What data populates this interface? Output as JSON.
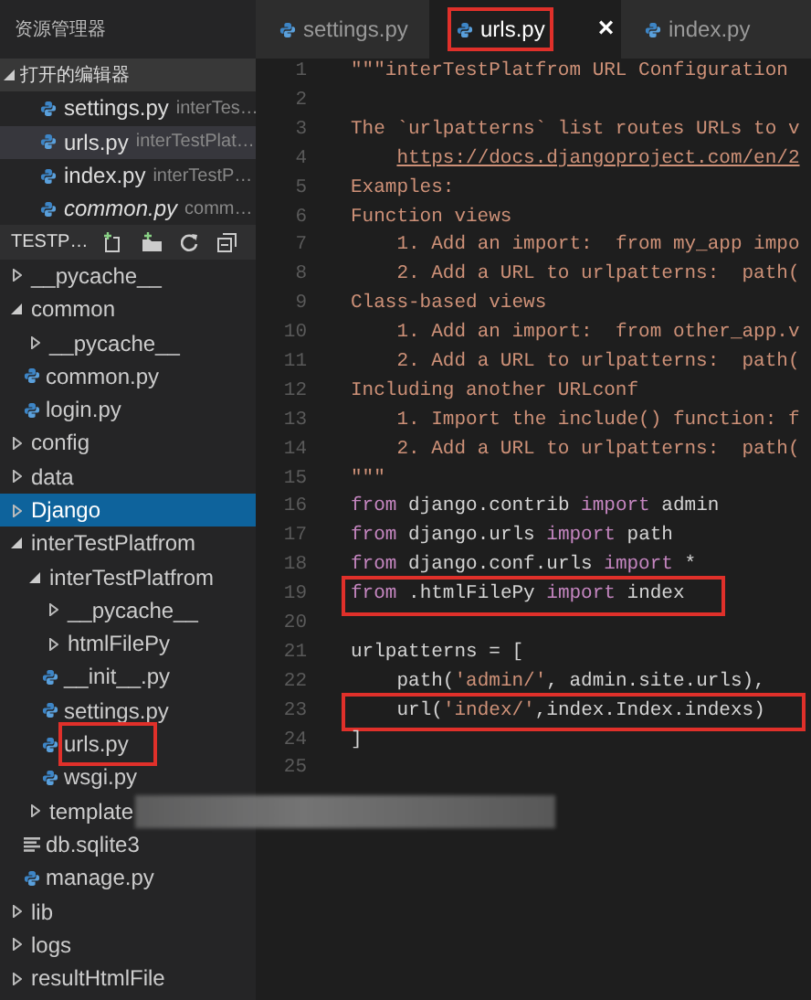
{
  "explorer": {
    "title": "资源管理器",
    "open_editors": {
      "title": "打开的编辑器",
      "expanded": true,
      "items": [
        {
          "name": "settings.py",
          "description": "interTes…",
          "selected": false,
          "preview": false
        },
        {
          "name": "urls.py",
          "description": "interTestPlat…",
          "selected": true,
          "preview": false
        },
        {
          "name": "index.py",
          "description": "interTestP…",
          "selected": false,
          "preview": false
        },
        {
          "name": "common.py",
          "description": "comm…",
          "selected": false,
          "preview": true
        }
      ]
    },
    "project": {
      "title": "TESTP…",
      "tree": [
        {
          "name": "__pycache__",
          "kind": "folder",
          "expanded": false,
          "selected": false,
          "highlighted": false
        },
        {
          "name": "common",
          "kind": "folder",
          "expanded": true,
          "selected": false,
          "highlighted": false,
          "children": [
            {
              "name": "__pycache__",
              "kind": "folder",
              "expanded": false,
              "selected": false,
              "highlighted": false
            },
            {
              "name": "common.py",
              "kind": "python",
              "selected": false,
              "highlighted": false
            },
            {
              "name": "login.py",
              "kind": "python",
              "selected": false,
              "highlighted": false
            }
          ]
        },
        {
          "name": "config",
          "kind": "folder",
          "expanded": false,
          "selected": false,
          "highlighted": false
        },
        {
          "name": "data",
          "kind": "folder",
          "expanded": false,
          "selected": false,
          "highlighted": false
        },
        {
          "name": "Django",
          "kind": "folder",
          "expanded": false,
          "selected": true,
          "highlighted": false
        },
        {
          "name": "interTestPlatfrom",
          "kind": "folder",
          "expanded": true,
          "selected": false,
          "highlighted": false,
          "children": [
            {
              "name": "interTestPlatfrom",
              "kind": "folder",
              "expanded": true,
              "selected": false,
              "highlighted": false,
              "children": [
                {
                  "name": "__pycache__",
                  "kind": "folder",
                  "expanded": false,
                  "selected": false,
                  "highlighted": false
                },
                {
                  "name": "htmlFilePy",
                  "kind": "folder",
                  "expanded": false,
                  "selected": false,
                  "highlighted": false
                },
                {
                  "name": "__init__.py",
                  "kind": "python",
                  "selected": false,
                  "highlighted": false
                },
                {
                  "name": "settings.py",
                  "kind": "python",
                  "selected": false,
                  "highlighted": false
                },
                {
                  "name": "urls.py",
                  "kind": "python",
                  "selected": false,
                  "highlighted": true
                },
                {
                  "name": "wsgi.py",
                  "kind": "python",
                  "selected": false,
                  "highlighted": false
                }
              ]
            },
            {
              "name": "template",
              "kind": "folder",
              "expanded": false,
              "selected": false,
              "highlighted": false,
              "redacted": true
            },
            {
              "name": "db.sqlite3",
              "kind": "text",
              "selected": false,
              "highlighted": false
            },
            {
              "name": "manage.py",
              "kind": "python",
              "selected": false,
              "highlighted": false
            }
          ]
        },
        {
          "name": "lib",
          "kind": "folder",
          "expanded": false,
          "selected": false,
          "highlighted": false
        },
        {
          "name": "logs",
          "kind": "folder",
          "expanded": false,
          "selected": false,
          "highlighted": false
        },
        {
          "name": "resultHtmlFile",
          "kind": "folder",
          "expanded": false,
          "selected": false,
          "highlighted": false
        }
      ]
    }
  },
  "tabs": [
    {
      "label": "settings.py",
      "selected": false,
      "highlighted": false
    },
    {
      "label": "urls.py",
      "selected": true,
      "highlighted": true,
      "close": "×"
    },
    {
      "label": "index.py",
      "selected": false,
      "highlighted": false
    }
  ],
  "editor": {
    "lines": [
      {
        "number": "1",
        "highlighted": false,
        "tokens": [
          {
            "kind": "doc",
            "text": "\"\"\"interTestPlatfrom URL Configuration"
          }
        ]
      },
      {
        "number": "2",
        "highlighted": false
      },
      {
        "number": "3",
        "highlighted": false,
        "tokens": [
          {
            "kind": "doc",
            "text": "The `urlpatterns` list routes URLs to v"
          }
        ]
      },
      {
        "number": "4",
        "highlighted": false,
        "tokens": [
          {
            "kind": "link",
            "text": "    https://docs.djangoproject.com/en/2"
          }
        ]
      },
      {
        "number": "5",
        "highlighted": false,
        "tokens": [
          {
            "kind": "doc",
            "text": "Examples:"
          }
        ]
      },
      {
        "number": "6",
        "highlighted": false,
        "tokens": [
          {
            "kind": "doc",
            "text": "Function views"
          }
        ]
      },
      {
        "number": "7",
        "highlighted": false,
        "tokens": [
          {
            "kind": "doc",
            "text": "    1. Add an import:  from my_app impo"
          }
        ]
      },
      {
        "number": "8",
        "highlighted": false,
        "tokens": [
          {
            "kind": "doc",
            "text": "    2. Add a URL to urlpatterns:  path("
          }
        ]
      },
      {
        "number": "9",
        "highlighted": false,
        "tokens": [
          {
            "kind": "doc",
            "text": "Class-based views"
          }
        ]
      },
      {
        "number": "10",
        "highlighted": false,
        "tokens": [
          {
            "kind": "doc",
            "text": "    1. Add an import:  from other_app.v"
          }
        ]
      },
      {
        "number": "11",
        "highlighted": false,
        "tokens": [
          {
            "kind": "doc",
            "text": "    2. Add a URL to urlpatterns:  path("
          }
        ]
      },
      {
        "number": "12",
        "highlighted": false,
        "tokens": [
          {
            "kind": "doc",
            "text": "Including another URLconf"
          }
        ]
      },
      {
        "number": "13",
        "highlighted": false,
        "tokens": [
          {
            "kind": "doc",
            "text": "    1. Import the include() function: f"
          }
        ]
      },
      {
        "number": "14",
        "highlighted": false,
        "tokens": [
          {
            "kind": "doc",
            "text": "    2. Add a URL to urlpatterns:  path("
          }
        ]
      },
      {
        "number": "15",
        "highlighted": false,
        "tokens": [
          {
            "kind": "doc",
            "text": "\"\"\""
          }
        ]
      },
      {
        "number": "16",
        "highlighted": false,
        "tokens": [
          {
            "kind": "kw",
            "text": "from"
          },
          {
            "kind": "plain",
            "text": " django.contrib "
          },
          {
            "kind": "kw",
            "text": "import"
          },
          {
            "kind": "plain",
            "text": " admin"
          }
        ]
      },
      {
        "number": "17",
        "highlighted": false,
        "tokens": [
          {
            "kind": "kw",
            "text": "from"
          },
          {
            "kind": "plain",
            "text": " django.urls "
          },
          {
            "kind": "kw",
            "text": "import"
          },
          {
            "kind": "plain",
            "text": " path"
          }
        ]
      },
      {
        "number": "18",
        "highlighted": false,
        "tokens": [
          {
            "kind": "kw",
            "text": "from"
          },
          {
            "kind": "plain",
            "text": " django.conf.urls "
          },
          {
            "kind": "kw",
            "text": "import"
          },
          {
            "kind": "plain",
            "text": " *"
          }
        ]
      },
      {
        "number": "19",
        "highlighted": true,
        "tokens": [
          {
            "kind": "kw",
            "text": "from"
          },
          {
            "kind": "plain",
            "text": " .htmlFilePy "
          },
          {
            "kind": "kw",
            "text": "import"
          },
          {
            "kind": "plain",
            "text": " index"
          }
        ]
      },
      {
        "number": "20",
        "highlighted": false
      },
      {
        "number": "21",
        "highlighted": false,
        "tokens": [
          {
            "kind": "plain",
            "text": "urlpatterns = ["
          }
        ]
      },
      {
        "number": "22",
        "highlighted": false,
        "tokens": [
          {
            "kind": "plain",
            "text": "    path("
          },
          {
            "kind": "str",
            "text": "'admin/'"
          },
          {
            "kind": "plain",
            "text": ", admin.site.urls),"
          }
        ]
      },
      {
        "number": "23",
        "highlighted": true,
        "tokens": [
          {
            "kind": "plain",
            "text": "    url("
          },
          {
            "kind": "str",
            "text": "'index/'"
          },
          {
            "kind": "plain",
            "text": ",index.Index.indexs)"
          }
        ]
      },
      {
        "number": "24",
        "highlighted": false,
        "tokens": [
          {
            "kind": "plain",
            "text": "]"
          }
        ]
      },
      {
        "number": "25",
        "highlighted": false
      }
    ]
  }
}
